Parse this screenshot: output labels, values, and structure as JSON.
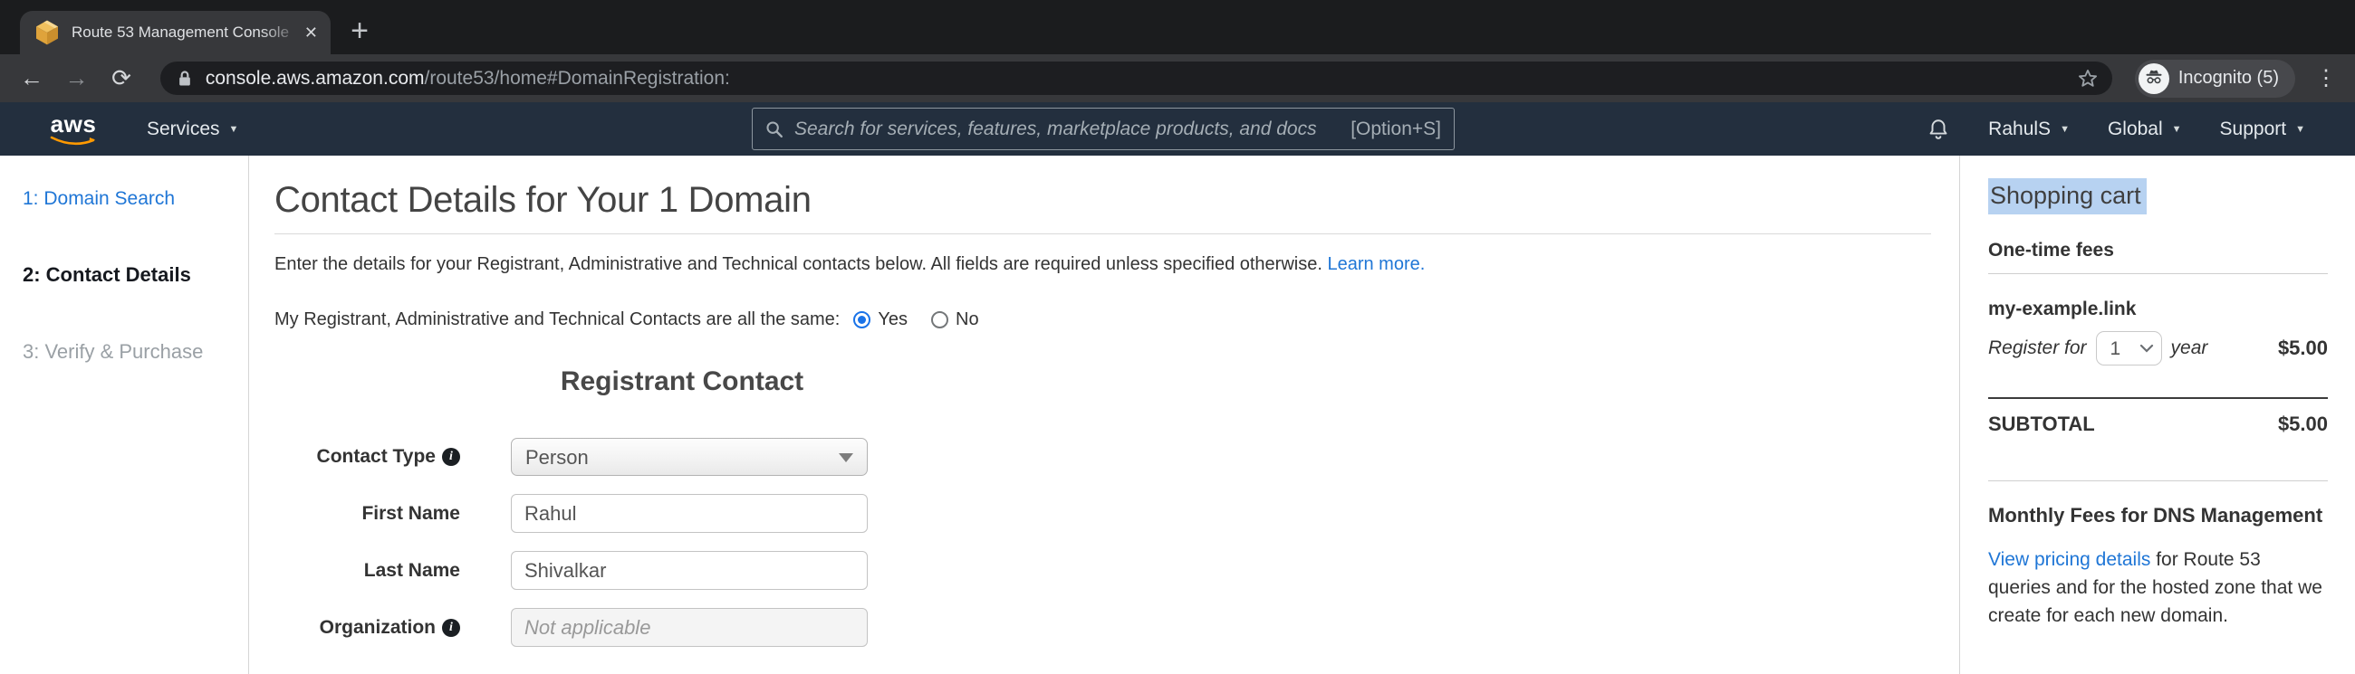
{
  "browser": {
    "tab_title": "Route 53 Management Console",
    "url_domain": "console.aws.amazon.com",
    "url_path": "/route53/home#DomainRegistration:",
    "incognito_label": "Incognito (5)",
    "icons": {
      "back": "←",
      "forward": "→",
      "reload": "⟳",
      "close": "✕",
      "new_tab": "+",
      "menu": "⋮"
    }
  },
  "awsnav": {
    "logo": "aws",
    "services": "Services",
    "caret": "▼",
    "search_placeholder": "Search for services, features, marketplace products, and docs",
    "search_shortcut": "[Option+S]",
    "user": "RahulS",
    "region": "Global",
    "support": "Support"
  },
  "steps": {
    "items": [
      {
        "label": "1: Domain Search",
        "state": "done"
      },
      {
        "label": "2: Contact Details",
        "state": "current"
      },
      {
        "label": "3: Verify & Purchase",
        "state": "todo"
      }
    ]
  },
  "main": {
    "title": "Contact Details for Your 1 Domain",
    "description": "Enter the details for your Registrant, Administrative and Technical contacts below. All fields are required unless specified otherwise.",
    "learn_more": "Learn more.",
    "same_question": "My Registrant, Administrative and Technical Contacts are all the same:",
    "yes_label": "Yes",
    "no_label": "No"
  },
  "form": {
    "heading": "Registrant Contact",
    "contact_type": {
      "label": "Contact Type",
      "value": "Person"
    },
    "first_name": {
      "label": "First Name",
      "value": "Rahul"
    },
    "last_name": {
      "label": "Last Name",
      "value": "Shivalkar"
    },
    "organization": {
      "label": "Organization",
      "placeholder": "Not applicable"
    },
    "info_icon_glyph": "i"
  },
  "cart": {
    "title": "Shopping cart",
    "one_time_fees": "One-time fees",
    "item": {
      "domain": "my-example.link",
      "register_for": "Register for",
      "years": "1",
      "year_label": "year",
      "price": "$5.00"
    },
    "subtotal_label": "SUBTOTAL",
    "subtotal_value": "$5.00",
    "monthly_heading": "Monthly Fees for DNS Management",
    "monthly_link": "View pricing details",
    "monthly_rest": " for Route 53 queries and for the hosted zone that we create for each new domain."
  },
  "colors": {
    "aws_navy": "#232f3e",
    "aws_orange": "#ff9900",
    "link_blue": "#1f76d6",
    "radio_blue": "#1a73e8",
    "selection_highlight": "#b7d2f1"
  }
}
